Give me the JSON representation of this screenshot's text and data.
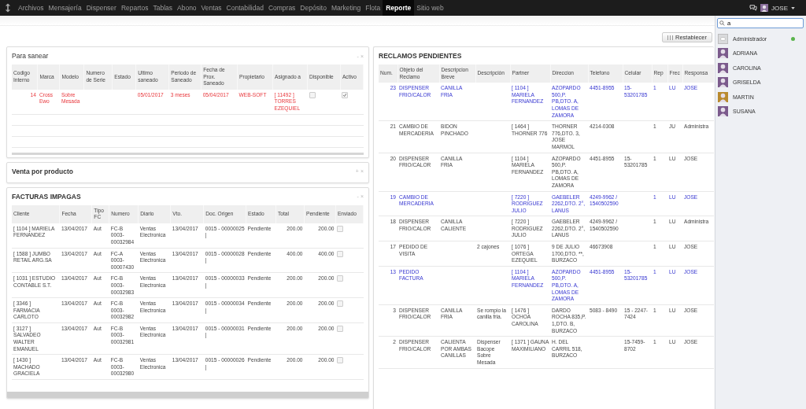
{
  "navbar": {
    "menu": [
      {
        "label": "Archivos",
        "selected": false
      },
      {
        "label": "Mensajería",
        "selected": false
      },
      {
        "label": "Dispenser",
        "selected": false
      },
      {
        "label": "Repartos",
        "selected": false
      },
      {
        "label": "Tablas",
        "selected": false
      },
      {
        "label": "Abono",
        "selected": false
      },
      {
        "label": "Ventas",
        "selected": false
      },
      {
        "label": "Contabilidad",
        "selected": false
      },
      {
        "label": "Compras",
        "selected": false
      },
      {
        "label": "Depósito",
        "selected": false
      },
      {
        "label": "Marketing",
        "selected": false
      },
      {
        "label": "Flota",
        "selected": false
      },
      {
        "label": "Reporte",
        "selected": true
      },
      {
        "label": "Sitio web",
        "selected": false
      }
    ],
    "user": "JOSE"
  },
  "toolbar": {
    "reset_button": "Restablecer"
  },
  "para_sanear": {
    "title": "Para sanear",
    "controls": [
      "-",
      "×"
    ],
    "columns": [
      "Codigo Interno",
      "Marca",
      "Modelo",
      "Numero de Serie",
      "Estado",
      "Ultimo saneado",
      "Periodo de Saneado",
      "Fecha de Prox. Saneado",
      "Propietario",
      "Asignado a",
      "Disponible",
      "Activo"
    ],
    "rows": [
      {
        "alert": true,
        "cells": [
          "14",
          "Cross Ewo",
          "Sobre Mesada",
          null,
          null,
          "05/01/2017",
          "3 meses",
          "05/04/2017",
          "WEB-SOFT",
          "[ 11492 ] TORRES EZEQUIEL"
        ],
        "available": false,
        "active": true
      }
    ]
  },
  "venta_por_producto": {
    "title": "Venta por producto",
    "controls": [
      "+",
      "×"
    ]
  },
  "facturas_impagas": {
    "title": "FACTURAS IMPAGAS",
    "controls": [
      "-",
      "×"
    ],
    "columns": [
      "Cliente",
      "Fecha",
      "Tipo FC",
      "Numero",
      "Diario",
      "Vto.",
      "Doc. Origen",
      "Estado",
      "Total",
      "Pendiente",
      "Enviado"
    ],
    "rows": [
      {
        "cells": [
          "[ 1104 ] MARIELA FERNANDEZ",
          "13/04/2017",
          "Aut",
          "FC-B 0003-00032984",
          "Ventas Electronica",
          "13/04/2017",
          "0015 - 00000025 |",
          "Pendiente",
          "200.00",
          "200.00"
        ],
        "sent": false
      },
      {
        "cells": [
          "[ 1588 ] JUMBO RETAIL ARG.SA",
          "13/04/2017",
          "Aut",
          "FC-A 0003-00007430",
          "Ventas Electronica",
          "13/04/2017",
          "0015 - 00000028 |",
          "Pendiente",
          "400.00",
          "400.00"
        ],
        "sent": false
      },
      {
        "cells": [
          "[ 1031 ] ESTUDIO CONTABLE S.T.",
          "13/04/2017",
          "Aut",
          "FC-B 0003-00032983",
          "Ventas Electronica",
          "13/04/2017",
          "0015 - 00000033 |",
          "Pendiente",
          "200.00",
          "200.00"
        ],
        "sent": false
      },
      {
        "cells": [
          "[ 3346 ] FARMACIA CARLOTO",
          "13/04/2017",
          "Aut",
          "FC-B 0003-00032982",
          "Ventas Electronica",
          "13/04/2017",
          "0015 - 00000034 |",
          "Pendiente",
          "200.00",
          "200.00"
        ],
        "sent": false
      },
      {
        "cells": [
          "[ 3127 ] SALVADEO WALTER EMANUEL",
          "13/04/2017",
          "Aut",
          "FC-B 0003-00032981",
          "Ventas Electronica",
          "13/04/2017",
          "0015 - 00000031 |",
          "Pendiente",
          "200.00",
          "200.00"
        ],
        "sent": false
      },
      {
        "cells": [
          "[ 1430 ] MACHADO GRACIELA",
          "13/04/2017",
          "Aut",
          "FC-B 0003-00032980",
          "Ventas Electronica",
          "13/04/2017",
          "0015 - 00000026 |",
          "Pendiente",
          "200.00",
          "200.00"
        ],
        "sent": false
      }
    ]
  },
  "reclamos_pendientes": {
    "title": "RECLAMOS PENDIENTES",
    "columns": [
      "Num.",
      "Objeto del Reclamo",
      "Descripcion Breve",
      "Descripción",
      "Partner",
      "Direccion",
      "Telefono",
      "Celular",
      "Rep",
      "Frec",
      "Responsa"
    ],
    "rows": [
      {
        "highlighted": true,
        "cells": [
          "23",
          "DISPENSER FRIO/CALOR",
          "CANILLA FRIA",
          null,
          "[ 1104 ] MARIELA FERNANDEZ",
          "AZOPARDO 500,P. PB,DTO. A, LOMAS DE ZAMORA",
          "4451-8955",
          "15-53201785",
          "1",
          "LU",
          "JOSE"
        ]
      },
      {
        "highlighted": false,
        "cells": [
          "21",
          "CAMBIO DE MERCADERIA",
          "BIDON PINCHADO",
          null,
          "[ 1464 ] THORNER 776",
          "THORNER 776,DTO. 3, JOSE MARMOL",
          "4214-0308",
          null,
          "1",
          "JU",
          "Administra"
        ]
      },
      {
        "highlighted": false,
        "cells": [
          "20",
          "DISPENSER FRIO/CALOR",
          "CANILLA FRIA",
          null,
          "[ 1104 ] MARIELA FERNANDEZ",
          "AZOPARDO 500,P. PB,DTO. A, LOMAS DE ZAMORA",
          "4451-8955",
          "15-53201785",
          "1",
          "LU",
          "JOSE"
        ]
      },
      {
        "highlighted": true,
        "cells": [
          "19",
          "CAMBIO DE MERCADERIA",
          null,
          null,
          "[ 7220 ] RODRIGUEZ JULIO",
          "GAEBELER 2262,DTO. 2°, LANUS",
          "4249-9962 / 1540502590",
          null,
          "1",
          "LU",
          "JOSE"
        ]
      },
      {
        "highlighted": false,
        "cells": [
          "18",
          "DISPENSER FRIO/CALOR",
          "CANILLA CALIENTE",
          null,
          "[ 7220 ] RODRIGUEZ JULIO",
          "GAEBELER 2262,DTO. 2°, LANUS",
          "4249-9962 / 1540502590",
          null,
          "1",
          "LU",
          "Administra"
        ]
      },
      {
        "highlighted": false,
        "cells": [
          "17",
          "PEDIDO DE VISITA",
          null,
          "2 cajones",
          "[ 1076 ] ORTEGA EZEQUIEL",
          "9 DE JULIO 1700,DTO. **, BURZACO",
          "46673908",
          null,
          "1",
          "LU",
          "JOSE"
        ]
      },
      {
        "highlighted": true,
        "cells": [
          "13",
          "PEDIDO FACTURA",
          null,
          null,
          "[ 1104 ] MARIELA FERNANDEZ",
          "AZOPARDO 500,P. PB,DTO. A, LOMAS DE ZAMORA",
          "4451-8955",
          "15-53201785",
          "1",
          "LU",
          "JOSE"
        ]
      },
      {
        "highlighted": false,
        "cells": [
          "3",
          "DISPENSER FRIO/CALOR",
          "CANILLA FRIA",
          "Se rompio la canilla fria.",
          "[ 1476 ] OCHOA CAROLINA",
          "DARDO ROCHA 835,P. 1,DTO. B, BURZACO",
          "5083 - 8490",
          "15 - 2247-7424",
          "1",
          "LU",
          "JOSE"
        ]
      },
      {
        "highlighted": false,
        "cells": [
          "2",
          "DISPENSER FRIO/CALOR",
          "CALIENTA POR AMBAS CANILLAS",
          "Dispenser Bacope Sobre Mesada",
          "[ 1371 ] GAUNA MAXIMILIANO",
          "H. DEL CARRIL 518, BURZACO",
          null,
          "15-7459-8702",
          "1",
          "LU",
          "JOSE"
        ]
      }
    ]
  },
  "chat": {
    "search": {
      "value": "a"
    },
    "contacts": [
      {
        "name": "Administrador",
        "kind": "system",
        "online": true,
        "color": "#d9dadc"
      },
      {
        "name": "ADRIANA",
        "kind": "person",
        "online": false,
        "color": "#7b5a8c"
      },
      {
        "name": "CAROLINA",
        "kind": "person",
        "online": false,
        "color": "#7b5a8c"
      },
      {
        "name": "GRISELDA",
        "kind": "person",
        "online": false,
        "color": "#7b5a8c"
      },
      {
        "name": "MARTIN",
        "kind": "person",
        "online": false,
        "color": "#b98a2e"
      },
      {
        "name": "SUSANA",
        "kind": "person",
        "online": false,
        "color": "#7b5a8c"
      }
    ]
  }
}
